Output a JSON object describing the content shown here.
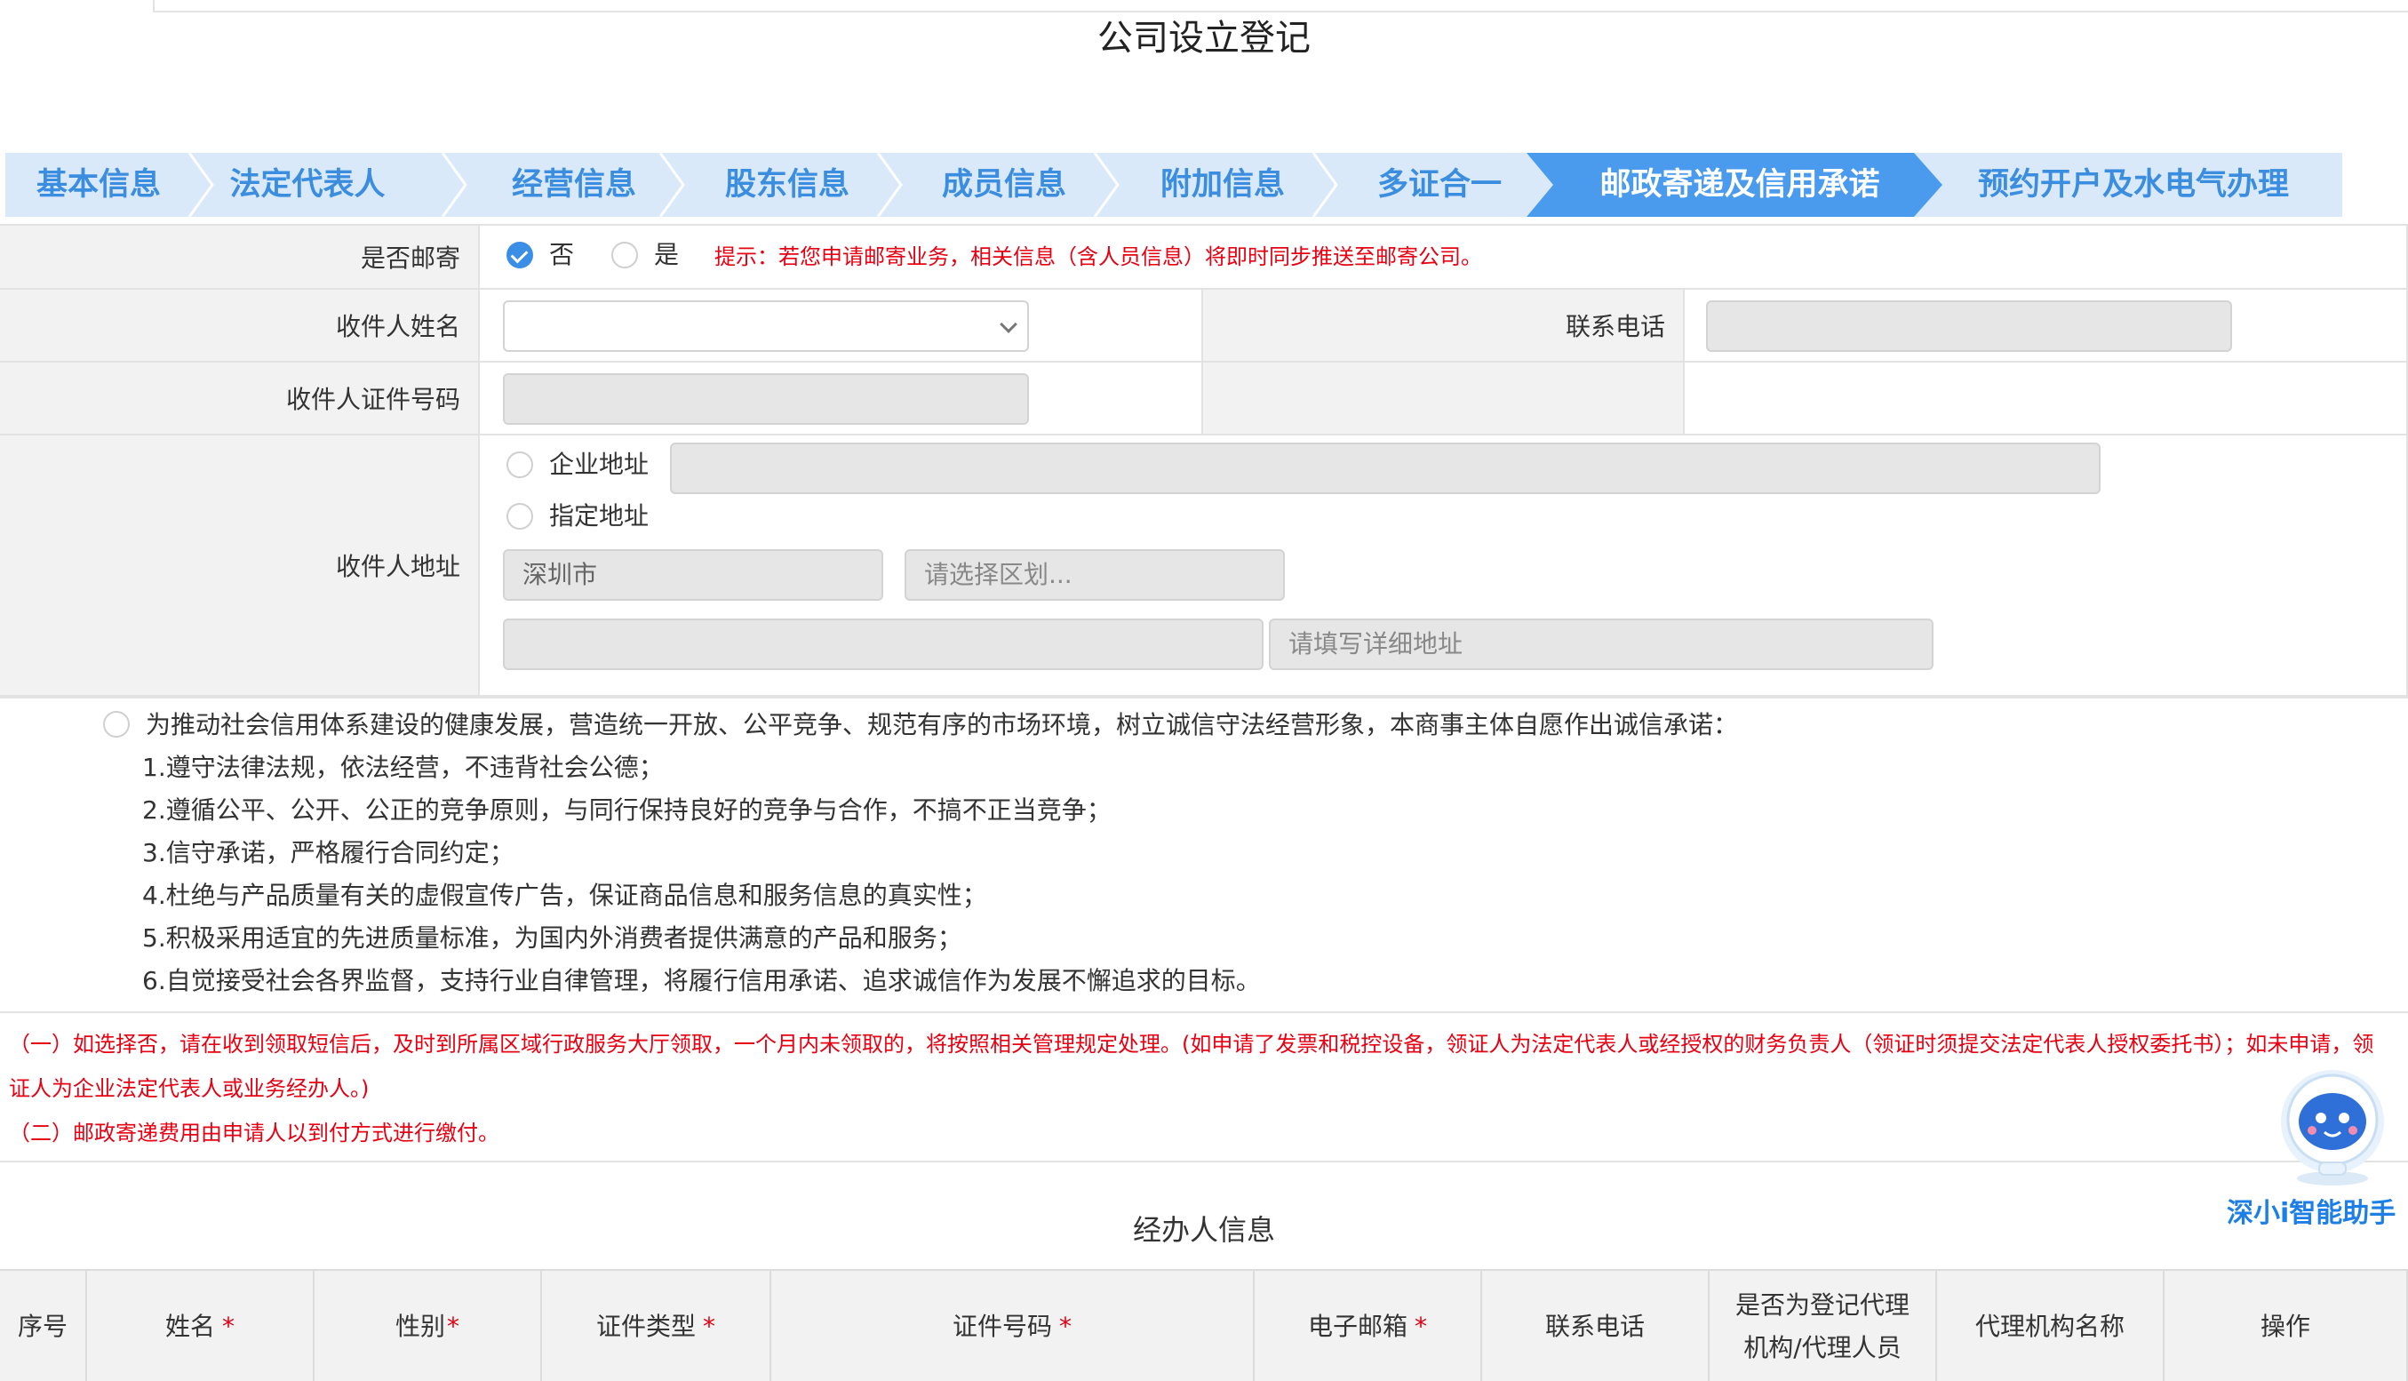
{
  "page": {
    "title": "公司设立登记"
  },
  "steps": [
    {
      "label": "基本信息"
    },
    {
      "label": "法定代表人"
    },
    {
      "label": "经营信息"
    },
    {
      "label": "股东信息"
    },
    {
      "label": "成员信息"
    },
    {
      "label": "附加信息"
    },
    {
      "label": "多证合一"
    },
    {
      "label": "邮政寄递及信用承诺",
      "active": true
    },
    {
      "label": "预约开户及水电气办理"
    }
  ],
  "form": {
    "mail": {
      "label": "是否邮寄",
      "options": [
        {
          "label": "否",
          "checked": true
        },
        {
          "label": "是",
          "checked": false
        }
      ],
      "hint": "提示：若您申请邮寄业务，相关信息（含人员信息）将即时同步推送至邮寄公司。"
    },
    "recipient_name": {
      "label": "收件人姓名",
      "value": ""
    },
    "phone": {
      "label": "联系电话",
      "value": ""
    },
    "id_number": {
      "label": "收件人证件号码",
      "value": ""
    },
    "address": {
      "label": "收件人地址",
      "options": [
        {
          "label": "企业地址",
          "checked": false
        },
        {
          "label": "指定地址",
          "checked": false
        }
      ],
      "city": "深圳市",
      "district_placeholder": "请选择区划...",
      "detail_placeholder": "请填写详细地址"
    }
  },
  "promise": {
    "intro": "为推动社会信用体系建设的健康发展，营造统一开放、公平竞争、规范有序的市场环境，树立诚信守法经营形象，本商事主体自愿作出诚信承诺：",
    "items": [
      "1.遵守法律法规，依法经营，不违背社会公德；",
      "2.遵循公平、公开、公正的竞争原则，与同行保持良好的竞争与合作，不搞不正当竞争；",
      "3.信守承诺，严格履行合同约定；",
      "4.杜绝与产品质量有关的虚假宣传广告，保证商品信息和服务信息的真实性；",
      "5.积极采用适宜的先进质量标准，为国内外消费者提供满意的产品和服务；",
      "6.自觉接受社会各界监督，支持行业自律管理，将履行信用承诺、追求诚信作为发展不懈追求的目标。"
    ],
    "notes": [
      "（一）如选择否，请在收到领取短信后，及时到所属区域行政服务大厅领取，一个月内未领取的，将按照相关管理规定处理。(如申请了发票和税控设备，领证人为法定代表人或经授权的财务负责人（领证时须提交法定代表人授权委托书）；如未申请，领",
      "证人为企业法定代表人或业务经办人。)",
      "（二）邮政寄递费用由申请人以到付方式进行缴付。"
    ]
  },
  "agent_section": {
    "title": "经办人信息",
    "columns": [
      {
        "label": "序号",
        "required": false
      },
      {
        "label": "姓名",
        "required": true
      },
      {
        "label": "性别",
        "required": true
      },
      {
        "label": "证件类型",
        "required": true
      },
      {
        "label": "证件号码",
        "required": true
      },
      {
        "label": "电子邮箱",
        "required": true
      },
      {
        "label": "联系电话",
        "required": false
      },
      {
        "label": "是否为登记代理机构/代理人员",
        "line1": "是否为登记代理",
        "line2": "机构/代理人员",
        "required": false
      },
      {
        "label": "代理机构名称",
        "required": false
      },
      {
        "label": "操作",
        "required": false
      }
    ],
    "required_mark": "*"
  },
  "assistant": {
    "label": "深小i智能助手"
  },
  "colors": {
    "primary": "#3b8de0",
    "active_step": "#4a9bee",
    "warning": "#e60012",
    "label_bg": "#f2f2f2"
  }
}
